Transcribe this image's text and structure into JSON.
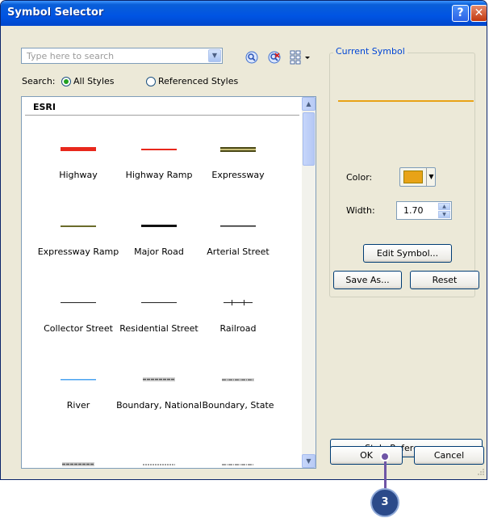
{
  "window": {
    "title": "Symbol Selector",
    "help_glyph": "?",
    "close_glyph": "✕"
  },
  "search": {
    "placeholder": "Type here to search",
    "value": "",
    "scope_label": "Search:",
    "options": [
      "All Styles",
      "Referenced Styles"
    ],
    "selected": "All Styles"
  },
  "list": {
    "group_header": "ESRI",
    "symbols": [
      {
        "label": "Highway",
        "swatch": "thick-red"
      },
      {
        "label": "Highway Ramp",
        "swatch": "thin-red"
      },
      {
        "label": "Expressway",
        "swatch": "double-olive"
      },
      {
        "label": "Expressway Ramp",
        "swatch": "thin-olive"
      },
      {
        "label": "Major Road",
        "swatch": "thick-black"
      },
      {
        "label": "Arterial Street",
        "swatch": "thin-black"
      },
      {
        "label": "Collector Street",
        "swatch": "hair-black"
      },
      {
        "label": "Residential Street",
        "swatch": "hair-black"
      },
      {
        "label": "Railroad",
        "swatch": "railroad"
      },
      {
        "label": "River",
        "swatch": "thin-blue"
      },
      {
        "label": "Boundary, National",
        "swatch": "dash-gray"
      },
      {
        "label": "Boundary, State",
        "swatch": "dash-gray"
      },
      {
        "label": "",
        "swatch": "dash-gray"
      },
      {
        "label": "",
        "swatch": "dot-gray"
      },
      {
        "label": "",
        "swatch": "dashdot-gray"
      }
    ]
  },
  "current_symbol": {
    "group_title": "Current Symbol",
    "preview_color": "#e8a317",
    "color_label": "Color:",
    "color_value": "#e8a317",
    "width_label": "Width:",
    "width_value": "1.70"
  },
  "buttons": {
    "edit_symbol": "Edit Symbol...",
    "save_as": "Save As...",
    "reset": "Reset",
    "style_references": "Style References...",
    "ok": "OK",
    "cancel": "Cancel"
  },
  "callout": {
    "number": "3",
    "color": "#2b4a8a"
  }
}
